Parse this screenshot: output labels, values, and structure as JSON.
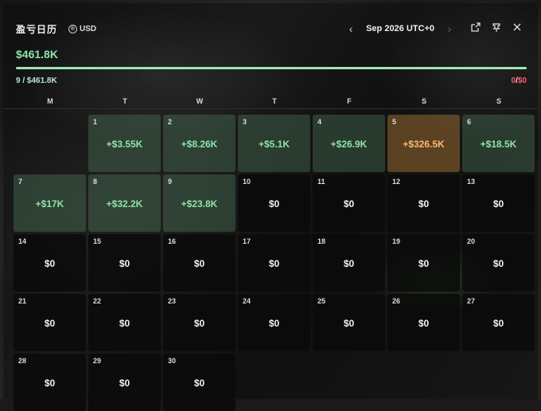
{
  "header": {
    "title": "盈亏日历",
    "currency": "USD",
    "month": "Sep 2026 UTC+0"
  },
  "summary": {
    "total": "$461.8K",
    "progress": 1.0,
    "left_stat": "9 / $461.8K",
    "right_neg": "0",
    "right_slash": "/",
    "right_val": "$0"
  },
  "weekdays": [
    "M",
    "T",
    "W",
    "T",
    "F",
    "S",
    "S"
  ],
  "days": [
    {
      "day": "",
      "value": "",
      "kind": "empty"
    },
    {
      "day": "1",
      "value": "+$3.55K",
      "kind": "pos"
    },
    {
      "day": "2",
      "value": "+$8.26K",
      "kind": "pos"
    },
    {
      "day": "3",
      "value": "+$5.1K",
      "kind": "pos"
    },
    {
      "day": "4",
      "value": "+$26.9K",
      "kind": "pos"
    },
    {
      "day": "5",
      "value": "+$326.5K",
      "kind": "big"
    },
    {
      "day": "6",
      "value": "+$18.5K",
      "kind": "pos"
    },
    {
      "day": "7",
      "value": "+$17K",
      "kind": "pos"
    },
    {
      "day": "8",
      "value": "+$32.2K",
      "kind": "pos"
    },
    {
      "day": "9",
      "value": "+$23.8K",
      "kind": "pos"
    },
    {
      "day": "10",
      "value": "$0",
      "kind": "zero"
    },
    {
      "day": "11",
      "value": "$0",
      "kind": "zero"
    },
    {
      "day": "12",
      "value": "$0",
      "kind": "zero"
    },
    {
      "day": "13",
      "value": "$0",
      "kind": "zero"
    },
    {
      "day": "14",
      "value": "$0",
      "kind": "zero"
    },
    {
      "day": "15",
      "value": "$0",
      "kind": "zero"
    },
    {
      "day": "16",
      "value": "$0",
      "kind": "zero"
    },
    {
      "day": "17",
      "value": "$0",
      "kind": "zero"
    },
    {
      "day": "18",
      "value": "$0",
      "kind": "zero"
    },
    {
      "day": "19",
      "value": "$0",
      "kind": "zero"
    },
    {
      "day": "20",
      "value": "$0",
      "kind": "zero"
    },
    {
      "day": "21",
      "value": "$0",
      "kind": "zero"
    },
    {
      "day": "22",
      "value": "$0",
      "kind": "zero"
    },
    {
      "day": "23",
      "value": "$0",
      "kind": "zero"
    },
    {
      "day": "24",
      "value": "$0",
      "kind": "zero"
    },
    {
      "day": "25",
      "value": "$0",
      "kind": "zero"
    },
    {
      "day": "26",
      "value": "$0",
      "kind": "zero"
    },
    {
      "day": "27",
      "value": "$0",
      "kind": "zero"
    },
    {
      "day": "28",
      "value": "$0",
      "kind": "zero"
    },
    {
      "day": "29",
      "value": "$0",
      "kind": "zero"
    },
    {
      "day": "30",
      "value": "$0",
      "kind": "zero"
    }
  ],
  "colors": {
    "positive": "#8fe3a8",
    "highlight": "#ffb870",
    "negative": "#ff5a6e"
  },
  "icons": {
    "prev": "chevron-left-icon",
    "next": "chevron-right-icon",
    "share": "external-link-icon",
    "pin": "pin-icon",
    "close": "close-icon"
  }
}
